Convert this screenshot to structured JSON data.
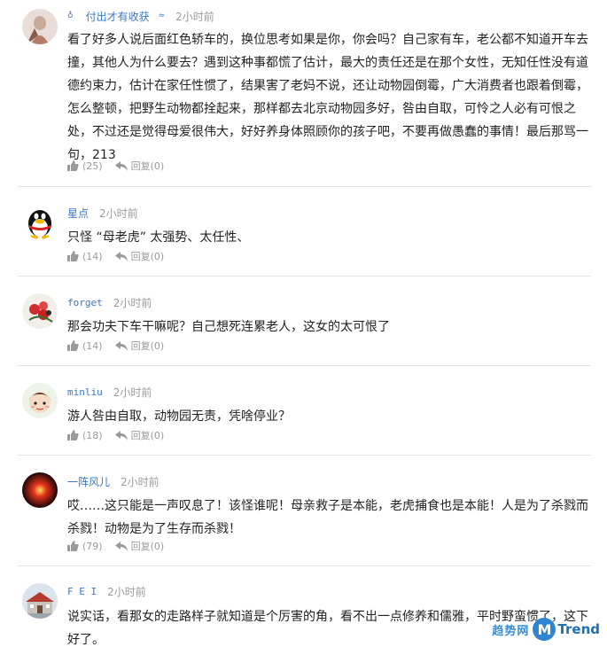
{
  "comments": [
    {
      "user": "付出才有收获",
      "time": "2小时前",
      "text": "看了好多人说后面红色轿车的，换位思考如果是你，你会吗？自己家有车，老公都不知道开车去撞，其他人为什么要去？遇到这种事都慌了估计，最大的责任还是在那个女性，无知任性没有道德约束力，估计在家任性惯了，结果害了老妈不说，还让动物园倒霉，广大消费者也跟着倒霉，怎么整顿，把野生动物都拴起来，那样都去北京动物园多好，咎由自取，可怜之人必有可恨之处，不过还是觉得母爱很伟大，好好养身体照顾你的孩子吧，不要再做愚蠢的事情！最后那骂一句，213",
      "likes": "(25)",
      "reply": "回复",
      "reply_count": "(0)",
      "avatar_icon": "user-photo-avatar"
    },
    {
      "user": "星点",
      "time": "2小时前",
      "text": "只怪 “母老虎” 太强势、太任性、",
      "likes": "(14)",
      "reply": "回复",
      "reply_count": "(0)",
      "avatar_icon": "qq-penguin-avatar"
    },
    {
      "user": "forget",
      "time": "2小时前",
      "text": "那会功夫下车干嘛呢？自己想死连累老人，这女的太可恨了",
      "likes": "(14)",
      "reply": "回复",
      "reply_count": "(0)",
      "avatar_icon": "flower-avatar"
    },
    {
      "user": "minliu",
      "time": "2小时前",
      "text": "游人咎由自取，动物园无责，凭啥停业？",
      "likes": "(18)",
      "reply": "回复",
      "reply_count": "(0)",
      "avatar_icon": "cartoon-girl-avatar"
    },
    {
      "user": "一阵风儿",
      "time": "2小时前",
      "text": "哎……这只能是一声叹息了！该怪谁呢！母亲救子是本能，老虎捕食也是本能！人是为了杀戮而杀戮！动物是为了生存而杀戮！",
      "likes": "(79)",
      "reply": "回复",
      "reply_count": "(0)",
      "avatar_icon": "red-glow-avatar"
    },
    {
      "user": "F E I",
      "time": "2小时前",
      "text": "说实话，看那女的走路样子就知道是个厉害的角，看不出一点修养和儒雅，平时野蛮惯了，这下好了。",
      "avatar_icon": "building-avatar"
    }
  ],
  "watermark": {
    "cn": "趋势网",
    "m": "M",
    "en": "Trend"
  },
  "colors": {
    "username": "#3b78c2",
    "meta": "#9a9a9a",
    "divider": "#e4e4e4"
  }
}
